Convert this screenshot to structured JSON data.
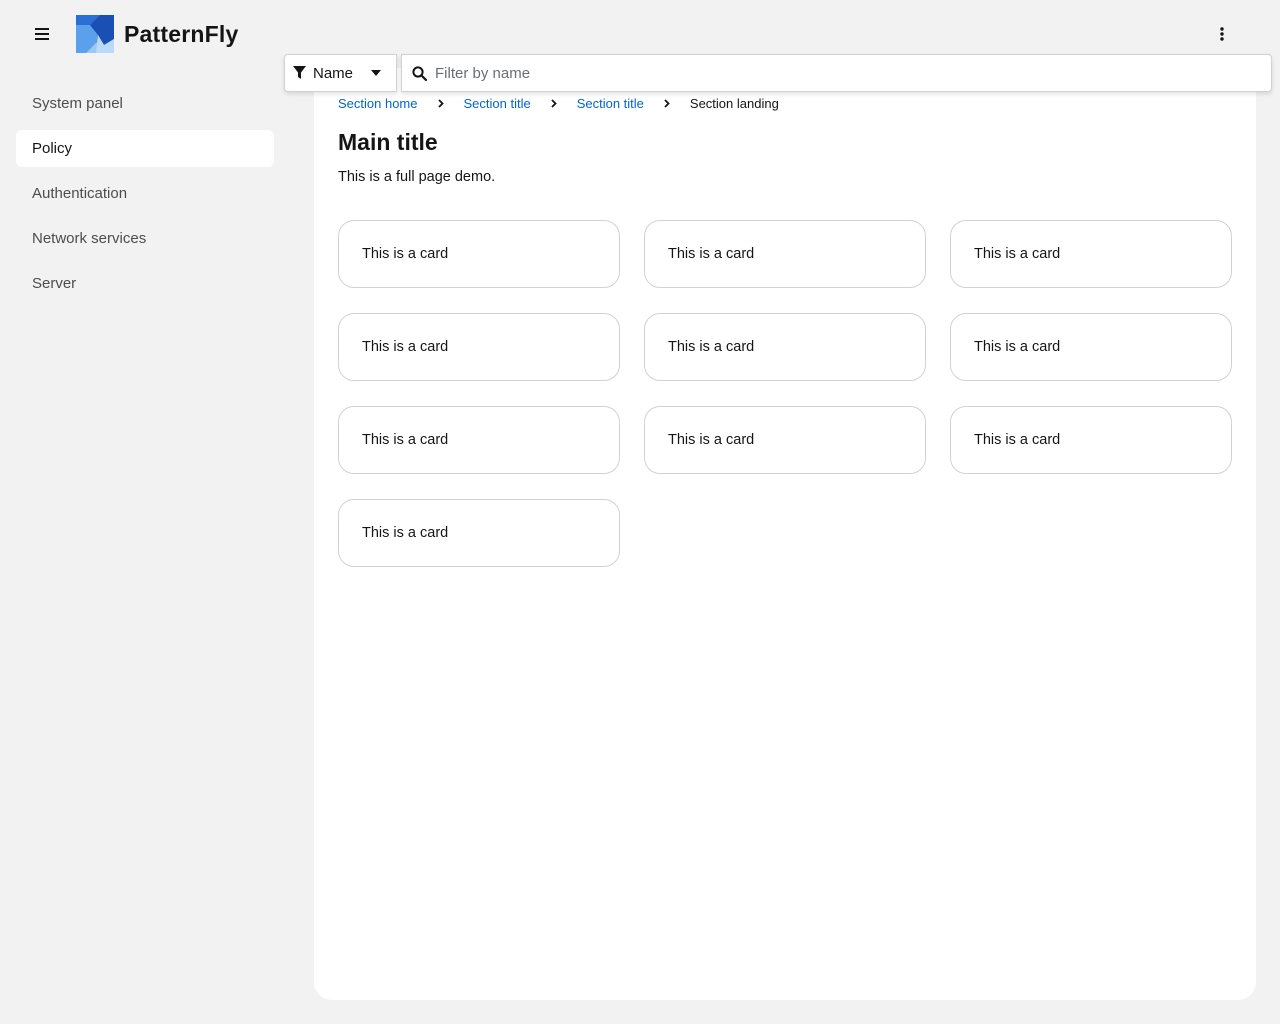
{
  "masthead": {
    "brand_name": "PatternFly",
    "menu_icon": "hamburger-icon",
    "options_icon": "kebab-icon"
  },
  "sidebar": {
    "items": [
      {
        "label": "System panel",
        "active": false
      },
      {
        "label": "Policy",
        "active": true
      },
      {
        "label": "Authentication",
        "active": false
      },
      {
        "label": "Network services",
        "active": false
      },
      {
        "label": "Server",
        "active": false
      }
    ]
  },
  "toolbar": {
    "filter_attribute": "Name",
    "filter_icon": "funnel-icon",
    "search_placeholder": "Filter by name",
    "search_value": ""
  },
  "breadcrumb": {
    "items": [
      {
        "label": "Section home",
        "link": true
      },
      {
        "label": "Section title",
        "link": true
      },
      {
        "label": "Section title",
        "link": true
      },
      {
        "label": "Section landing",
        "link": false
      }
    ]
  },
  "main": {
    "title": "Main title",
    "description": "This is a full page demo."
  },
  "cards": [
    "This is a card",
    "This is a card",
    "This is a card",
    "This is a card",
    "This is a card",
    "This is a card",
    "This is a card",
    "This is a card",
    "This is a card",
    "This is a card"
  ],
  "colors": {
    "link": "#0066cc",
    "background": "#f2f2f2",
    "panel": "#ffffff",
    "border": "#d2d2d2",
    "brand_blue": "#2b6fd6"
  }
}
